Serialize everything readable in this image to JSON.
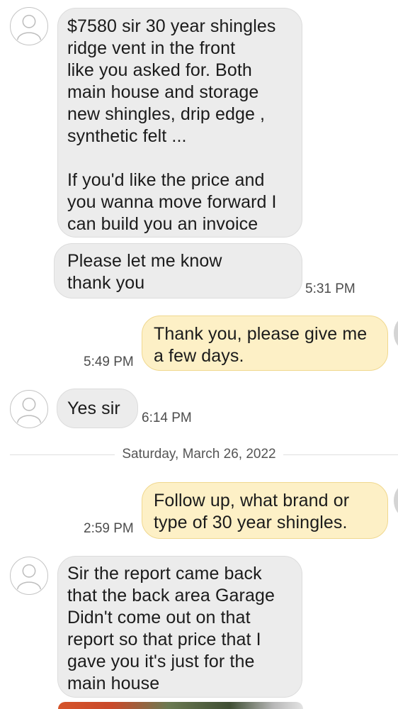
{
  "conversation": {
    "messages": [
      {
        "direction": "incoming",
        "text": "$7580 sir 30 year shingles\nridge vent in the front\nlike you asked for.  Both\nmain house and storage\nnew shingles, drip edge ,\nsynthetic felt  ...\n\nIf you'd like the price and\nyou wanna move forward I\ncan build you an invoice",
        "time": ""
      },
      {
        "direction": "incoming",
        "text": "Please let me know\nthank you",
        "time": "5:31 PM"
      },
      {
        "direction": "outgoing",
        "text": "Thank you, please give me\na few days.",
        "time": "5:49 PM"
      },
      {
        "direction": "incoming",
        "text": "Yes sir",
        "time": "6:14 PM"
      },
      {
        "direction": "outgoing",
        "text": "Follow up, what brand  or\ntype of 30 year shingles.",
        "time": "2:59 PM"
      },
      {
        "direction": "incoming",
        "text": "Sir the report came back\nthat the back area Garage\nDidn't come out on that\nreport so that price that I\ngave you it's just for the\nmain house",
        "time": ""
      }
    ],
    "date_separator": "Saturday, March 26, 2022"
  },
  "icons": {
    "contact_avatar": "person-outline-icon",
    "own_avatar": "person-avatar-icon"
  },
  "colors": {
    "incoming_bubble": "#ececec",
    "outgoing_bubble": "#fdf0c6",
    "outgoing_border": "#f0d88f",
    "timestamp": "#4d4d4d"
  }
}
